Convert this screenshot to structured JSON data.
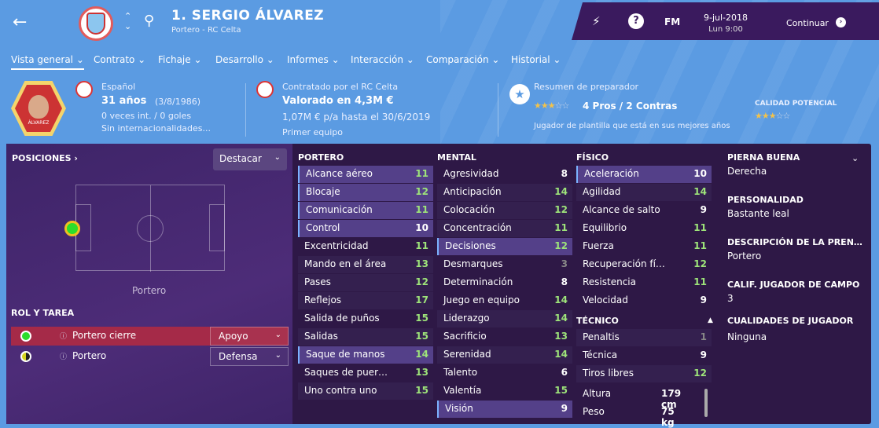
{
  "header": {
    "back_icon": "arrow-left-icon",
    "player_name": "1. SERGIO ÁLVAREZ",
    "player_sub": "Portero - RC Celta",
    "date": "9-jul-2018",
    "time": "Lun 9:00",
    "fm_label": "FM",
    "continue_label": "Continuar",
    "help_label": "?"
  },
  "tabs": [
    "Vista general ⌄",
    "Contrato ⌄",
    "Fichaje ⌄",
    "Desarrollo ⌄",
    "Informes ⌄",
    "Interacción ⌄",
    "Comparación ⌄",
    "Historial ⌄"
  ],
  "info": {
    "nationality": "Español",
    "age": "31 años",
    "birth": "(3/8/1986)",
    "caps": "0 veces int. / 0 goles",
    "intl": "Sin internacionalidades...",
    "contract_label": "Contratado por el RC Celta",
    "value": "Valorado en 4,3M €",
    "wage": "1,07M € p/a hasta el 30/6/2019",
    "squad": "Primer equipo",
    "coach_label": "Resumen de preparador",
    "pros_cons": "4 Pros / 2 Contras",
    "coach_desc": "Jugador de plantilla que está en sus mejores años",
    "potential_label": "CALIDAD POTENCIAL",
    "current_stars": 3,
    "potential_stars": 3,
    "jersey_text": "ÁLVAREZ"
  },
  "left": {
    "positions_title": "POSICIONES ›",
    "highlight_label": "Destacar",
    "position_name": "Portero",
    "role_title": "ROL Y TAREA",
    "roles": [
      {
        "name": "Portero cierre",
        "duty": "Apoyo",
        "color": "#2bdd2b",
        "selected": true
      },
      {
        "name": "Portero",
        "duty": "Defensa",
        "color": "#d4d420",
        "selected": false
      }
    ]
  },
  "columns": {
    "portero": {
      "title": "PORTERO",
      "attrs": [
        {
          "n": "Alcance aéreo",
          "v": "11",
          "c": "vg",
          "bg": "hi"
        },
        {
          "n": "Blocaje",
          "v": "12",
          "c": "vg",
          "bg": "hi"
        },
        {
          "n": "Comunicación",
          "v": "11",
          "c": "vg",
          "bg": "hi"
        },
        {
          "n": "Control",
          "v": "10",
          "c": "vw",
          "bg": "hi"
        },
        {
          "n": "Excentricidad",
          "v": "11",
          "c": "vg",
          "bg": "dk"
        },
        {
          "n": "Mando en el área",
          "v": "13",
          "c": "vg",
          "bg": "lo"
        },
        {
          "n": "Pases",
          "v": "12",
          "c": "vg",
          "bg": "lo"
        },
        {
          "n": "Reflejos",
          "v": "17",
          "c": "vg",
          "bg": "lo"
        },
        {
          "n": "Salida de puños",
          "v": "15",
          "c": "vg",
          "bg": "dk"
        },
        {
          "n": "Salidas",
          "v": "15",
          "c": "vg",
          "bg": "lo"
        },
        {
          "n": "Saque de manos",
          "v": "14",
          "c": "vg",
          "bg": "hi"
        },
        {
          "n": "Saques de puer…",
          "v": "13",
          "c": "vg",
          "bg": "dk"
        },
        {
          "n": "Uno contra uno",
          "v": "15",
          "c": "vg",
          "bg": "lo"
        }
      ]
    },
    "mental": {
      "title": "MENTAL",
      "attrs": [
        {
          "n": "Agresividad",
          "v": "8",
          "c": "vw",
          "bg": "dk"
        },
        {
          "n": "Anticipación",
          "v": "14",
          "c": "vg",
          "bg": "lo"
        },
        {
          "n": "Colocación",
          "v": "12",
          "c": "vg",
          "bg": "lo"
        },
        {
          "n": "Concentración",
          "v": "11",
          "c": "vg",
          "bg": "lo"
        },
        {
          "n": "Decisiones",
          "v": "12",
          "c": "vg",
          "bg": "hi"
        },
        {
          "n": "Desmarques",
          "v": "3",
          "c": "vf",
          "bg": "dk"
        },
        {
          "n": "Determinación",
          "v": "8",
          "c": "vw",
          "bg": "dk"
        },
        {
          "n": "Juego en equipo",
          "v": "14",
          "c": "vg",
          "bg": "dk"
        },
        {
          "n": "Liderazgo",
          "v": "14",
          "c": "vg",
          "bg": "lo"
        },
        {
          "n": "Sacrificio",
          "v": "13",
          "c": "vg",
          "bg": "dk"
        },
        {
          "n": "Serenidad",
          "v": "14",
          "c": "vg",
          "bg": "lo"
        },
        {
          "n": "Talento",
          "v": "6",
          "c": "vw",
          "bg": "dk"
        },
        {
          "n": "Valentía",
          "v": "15",
          "c": "vg",
          "bg": "dk"
        },
        {
          "n": "Visión",
          "v": "9",
          "c": "vw",
          "bg": "hi"
        }
      ]
    },
    "fisico": {
      "title": "FÍSICO",
      "attrs": [
        {
          "n": "Aceleración",
          "v": "10",
          "c": "vw",
          "bg": "hi"
        },
        {
          "n": "Agilidad",
          "v": "14",
          "c": "vg",
          "bg": "lo"
        },
        {
          "n": "Alcance de salto",
          "v": "9",
          "c": "vw",
          "bg": "dk"
        },
        {
          "n": "Equilibrio",
          "v": "11",
          "c": "vg",
          "bg": "dk"
        },
        {
          "n": "Fuerza",
          "v": "11",
          "c": "vg",
          "bg": "dk"
        },
        {
          "n": "Recuperación fí…",
          "v": "12",
          "c": "vg",
          "bg": "dk"
        },
        {
          "n": "Resistencia",
          "v": "11",
          "c": "vg",
          "bg": "dk"
        },
        {
          "n": "Velocidad",
          "v": "9",
          "c": "vw",
          "bg": "dk"
        }
      ]
    },
    "tecnico": {
      "title": "TÉCNICO",
      "attrs": [
        {
          "n": "Penaltis",
          "v": "1",
          "c": "vf",
          "bg": "lo"
        },
        {
          "n": "Técnica",
          "v": "9",
          "c": "vw",
          "bg": "dk"
        },
        {
          "n": "Tiros libres",
          "v": "12",
          "c": "vg",
          "bg": "lo"
        }
      ]
    },
    "physical_stats": [
      {
        "n": "Altura",
        "v": "179 cm"
      },
      {
        "n": "Peso",
        "v": "75 kg"
      }
    ]
  },
  "right": [
    {
      "t": "PIERNA BUENA",
      "v": "Derecha"
    },
    {
      "t": "PERSONALIDAD",
      "v": "Bastante leal"
    },
    {
      "t": "DESCRIPCIÓN DE LA PREN…",
      "v": "Portero"
    },
    {
      "t": "CALIF. JUGADOR DE CAMPO",
      "v": "3"
    },
    {
      "t": "CUALIDADES DE JUGADOR",
      "v": "Ninguna"
    }
  ]
}
